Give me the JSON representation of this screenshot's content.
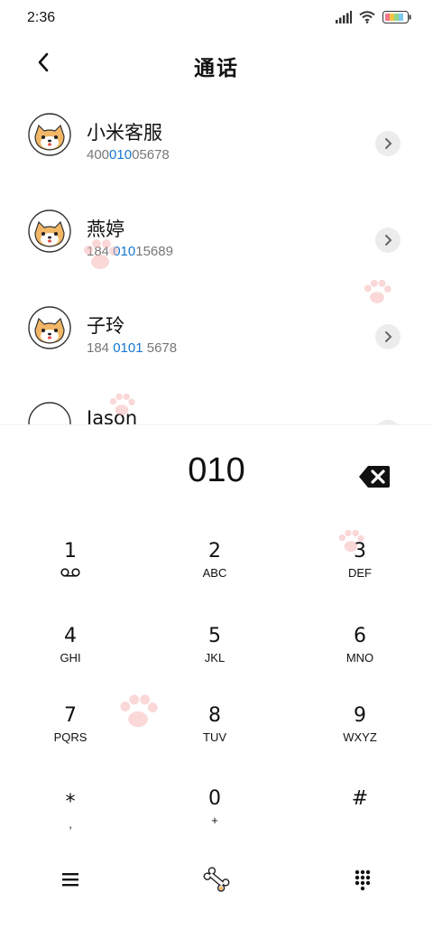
{
  "status_bar": {
    "time": "2:36"
  },
  "header": {
    "title": "通话"
  },
  "contacts": [
    {
      "name": "小米客服",
      "number_parts": [
        "400",
        "010",
        "05678"
      ]
    },
    {
      "name": "燕婷",
      "number_parts": [
        "184 ",
        "010",
        "15689"
      ]
    },
    {
      "name": "子玲",
      "number_parts": [
        "184 ",
        "0101",
        " 5678"
      ]
    },
    {
      "name": "Jason"
    }
  ],
  "dialer": {
    "display": "010",
    "keys": [
      {
        "digit": "1",
        "letters": ""
      },
      {
        "digit": "2",
        "letters": "ABC"
      },
      {
        "digit": "3",
        "letters": "DEF"
      },
      {
        "digit": "4",
        "letters": "GHI"
      },
      {
        "digit": "5",
        "letters": "JKL"
      },
      {
        "digit": "6",
        "letters": "MNO"
      },
      {
        "digit": "7",
        "letters": "PQRS"
      },
      {
        "digit": "8",
        "letters": "TUV"
      },
      {
        "digit": "9",
        "letters": "WXYZ"
      },
      {
        "digit": "*",
        "letters": ","
      },
      {
        "digit": "0",
        "letters": "+"
      },
      {
        "digit": "#",
        "letters": ""
      }
    ]
  },
  "icons": {
    "voicemail": "voicemail-icon",
    "menu": "menu-icon",
    "bone": "bone-icon",
    "keypad": "keypad-icon"
  },
  "colors": {
    "highlight": "#1677d2",
    "paw": "#f7b3b3"
  }
}
